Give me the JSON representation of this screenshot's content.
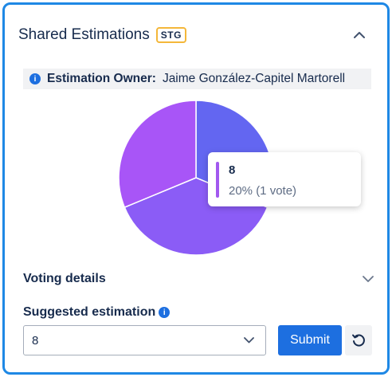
{
  "panel": {
    "title": "Shared Estimations",
    "badge": "STG"
  },
  "owner": {
    "label": "Estimation Owner:",
    "name": "Jaime González-Capitel Martorell",
    "info_icon": "i"
  },
  "chart_data": {
    "type": "pie",
    "slices": [
      {
        "name": "8",
        "value": 0.2,
        "color": "#a259ef"
      },
      {
        "name": "",
        "value": 0.25,
        "color": "#6366f1"
      },
      {
        "name": "",
        "value": 0.3,
        "color": "#8b5cf6"
      },
      {
        "name": "",
        "value": 0.25,
        "color": "#a855f7"
      }
    ],
    "tooltip": {
      "label": "8",
      "value": "20% (1 vote)"
    }
  },
  "voting": {
    "label": "Voting details"
  },
  "suggested": {
    "label": "Suggested estimation",
    "info_icon": "i",
    "selected_value": "8"
  },
  "actions": {
    "submit_label": "Submit"
  },
  "icons": {
    "collapse": "chevron-up-icon",
    "expand": "chevron-down-icon",
    "reset": "reset-icon"
  },
  "colors": {
    "accent": "#1d6fe0",
    "frame": "#1e88e5",
    "badge_border": "#f4b73a"
  }
}
